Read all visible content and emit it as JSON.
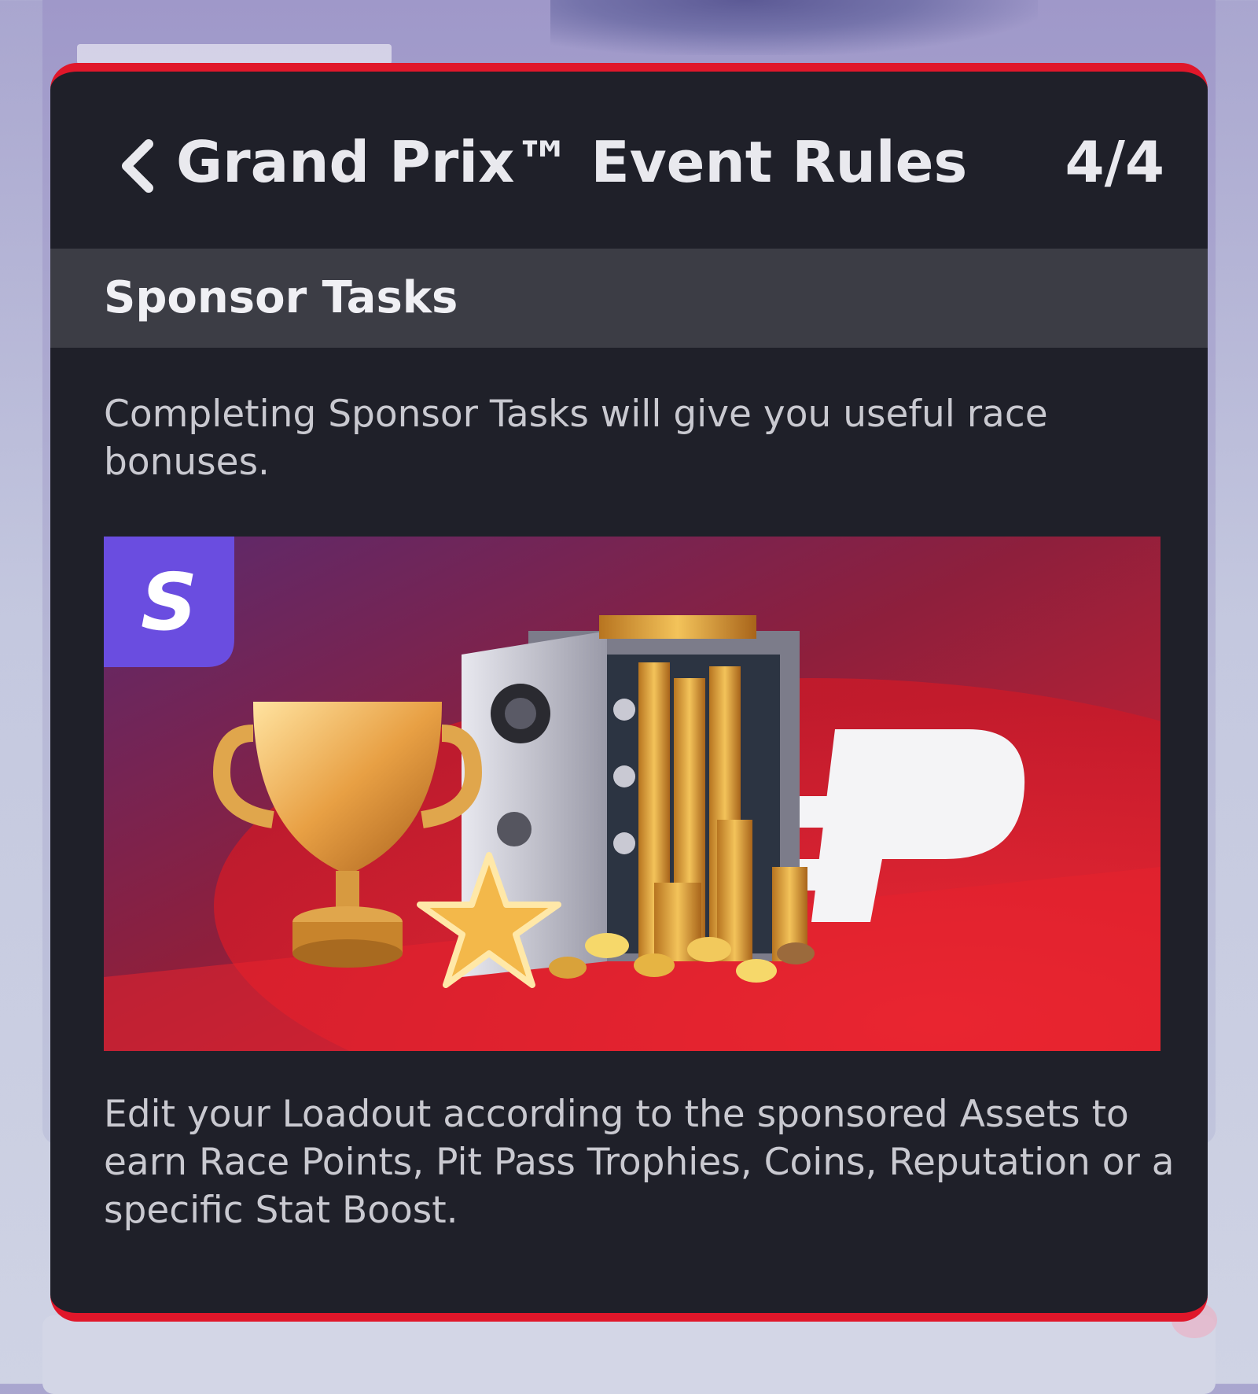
{
  "header": {
    "back_icon": "chevron-left-icon",
    "title": "Grand Prix™ Event Rules",
    "page_counter": "4/4"
  },
  "section": {
    "title": "Sponsor Tasks"
  },
  "content": {
    "intro": "Completing Sponsor Tasks will give you useful race bonuses.",
    "body": "Edit your Loadout according to the sponsored Assets to earn Race Points, Pit Pass Trophies, Coins, Reputation or a specific Stat Boost."
  },
  "banner": {
    "badge_icon": "sponsor-icon",
    "illustration": [
      "trophy-icon",
      "star-icon",
      "safe-icon",
      "coins-icon",
      "pit-pass-logo"
    ]
  },
  "colors": {
    "accent": "#e0172a",
    "modal_bg": "#1f2029",
    "section_bar": "#3c3d45",
    "badge": "#6a4de0"
  }
}
